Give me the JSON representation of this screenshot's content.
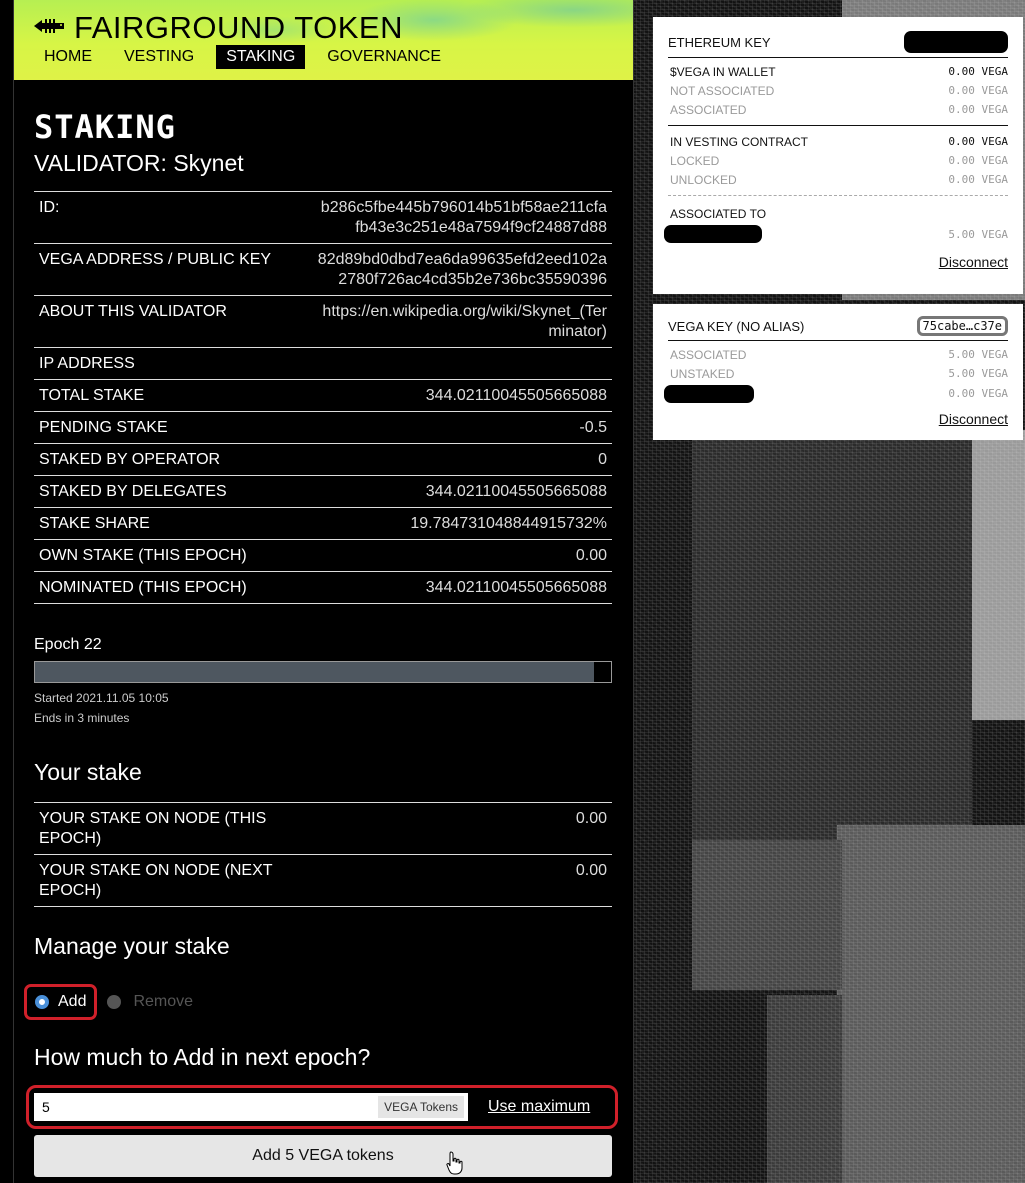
{
  "app": {
    "title": "FAIRGROUND TOKEN",
    "nav": [
      "HOME",
      "VESTING",
      "STAKING",
      "GOVERNANCE"
    ],
    "active_nav": "STAKING"
  },
  "page": {
    "heading": "STAKING",
    "validator_title": "VALIDATOR: Skynet",
    "details": [
      {
        "label": "ID:",
        "value": "b286c5fbe445b796014b51bf58ae211cfafb43e3c251e48a7594f9cf24887d88"
      },
      {
        "label": "VEGA ADDRESS / PUBLIC KEY",
        "value": "82d89bd0dbd7ea6da99635efd2eed102a2780f726ac4cd35b2e736bc35590396"
      },
      {
        "label": "ABOUT THIS VALIDATOR",
        "value": "https://en.wikipedia.org/wiki/Skynet_(Terminator)"
      },
      {
        "label": "IP ADDRESS",
        "value": ""
      },
      {
        "label": "TOTAL STAKE",
        "value": "344.02110045505665088"
      },
      {
        "label": "PENDING STAKE",
        "value": "-0.5"
      },
      {
        "label": "STAKED BY OPERATOR",
        "value": "0"
      },
      {
        "label": "STAKED BY DELEGATES",
        "value": "344.02110045505665088"
      },
      {
        "label": "STAKE SHARE",
        "value": "19.784731048844915732%"
      },
      {
        "label": "OWN STAKE (THIS EPOCH)",
        "value": "0.00"
      },
      {
        "label": "NOMINATED (THIS EPOCH)",
        "value": "344.02110045505665088"
      }
    ],
    "epoch": {
      "label": "Epoch 22",
      "progress": 0.97,
      "started": "Started 2021.11.05 10:05",
      "ends": "Ends in 3 minutes"
    },
    "your_stake": {
      "heading": "Your stake",
      "rows": [
        {
          "label": "YOUR STAKE ON NODE (THIS EPOCH)",
          "value": "0.00"
        },
        {
          "label": "YOUR STAKE ON NODE (NEXT EPOCH)",
          "value": "0.00"
        }
      ]
    },
    "manage": {
      "heading": "Manage your stake",
      "add_label": "Add",
      "remove_label": "Remove",
      "selected": "Add",
      "amount_heading": "How much to Add in next epoch?",
      "amount_value": "5",
      "unit_label": "VEGA Tokens",
      "max_label": "Use maximum",
      "submit_label": "Add 5 VEGA tokens"
    }
  },
  "eth_wallet": {
    "title": "ETHEREUM KEY",
    "rows_a": [
      {
        "label": "$VEGA IN WALLET",
        "value": "0.00 VEGA",
        "muted": false
      },
      {
        "label": "NOT ASSOCIATED",
        "value": "0.00 VEGA",
        "muted": true
      },
      {
        "label": "ASSOCIATED",
        "value": "0.00 VEGA",
        "muted": true
      }
    ],
    "rows_b": [
      {
        "label": "IN VESTING CONTRACT",
        "value": "0.00 VEGA",
        "muted": false
      },
      {
        "label": "LOCKED",
        "value": "0.00 VEGA",
        "muted": true
      },
      {
        "label": "UNLOCKED",
        "value": "0.00 VEGA",
        "muted": true
      }
    ],
    "associated_to": "ASSOCIATED TO",
    "associated_value": "5.00 VEGA",
    "disconnect": "Disconnect"
  },
  "vega_wallet": {
    "title": "VEGA KEY (NO ALIAS)",
    "key": "75cabe…c37e",
    "rows": [
      {
        "label": "ASSOCIATED",
        "value": "5.00 VEGA"
      },
      {
        "label": "UNSTAKED",
        "value": "5.00 VEGA"
      }
    ],
    "redacted_value": "0.00 VEGA",
    "disconnect": "Disconnect"
  },
  "colors": {
    "header_lime": "#d7f546",
    "highlight_red": "#d0202a",
    "epoch_fill": "#4e5760"
  }
}
